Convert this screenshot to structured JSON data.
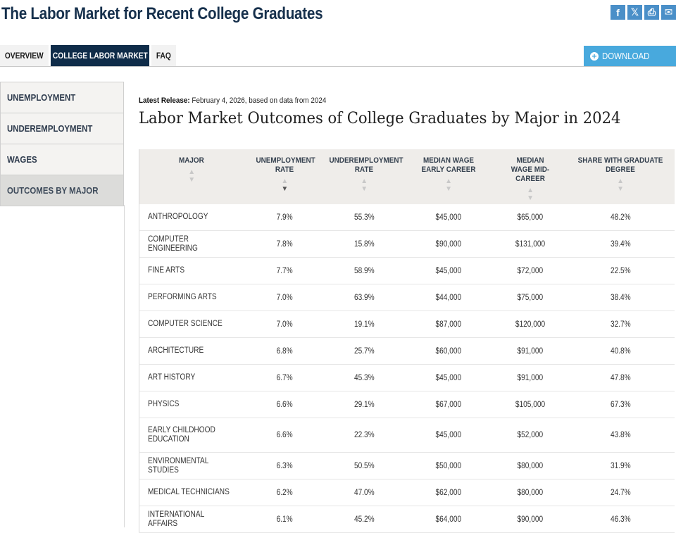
{
  "page_title": "The Labor Market for Recent College Graduates",
  "share_icons": [
    {
      "name": "facebook-icon",
      "glyph": "f"
    },
    {
      "name": "x-icon",
      "glyph": "𝕏"
    },
    {
      "name": "print-icon",
      "glyph": "⎙"
    },
    {
      "name": "email-icon",
      "glyph": "✉"
    }
  ],
  "tabs": {
    "overview": "OVERVIEW",
    "college_labor_market": "COLLEGE LABOR MARKET",
    "faq": "FAQ"
  },
  "download": {
    "icon": "+",
    "label": "DOWNLOAD"
  },
  "sidebar": {
    "items": [
      {
        "label": "UNEMPLOYMENT"
      },
      {
        "label": "UNDEREMPLOYMENT"
      },
      {
        "label": "WAGES"
      },
      {
        "label": "OUTCOMES BY MAJOR"
      }
    ]
  },
  "release": {
    "label": "Latest Release:",
    "text": "February 4, 2026, based on data from 2024"
  },
  "section_title": "Labor Market Outcomes of College Graduates by Major in 2024",
  "table": {
    "headers": [
      "MAJOR",
      "UNEMPLOYMENT RATE",
      "UNDEREMPLOYMENT RATE",
      "MEDIAN WAGE EARLY CAREER",
      "MEDIAN WAGE MID-CAREER",
      "SHARE WITH GRADUATE DEGREE"
    ],
    "sort_column": "UNEMPLOYMENT RATE",
    "sort_direction": "descending",
    "rows": [
      [
        "ANTHROPOLOGY",
        "7.9%",
        "55.3%",
        "$45,000",
        "$65,000",
        "48.2%"
      ],
      [
        "COMPUTER ENGINEERING",
        "7.8%",
        "15.8%",
        "$90,000",
        "$131,000",
        "39.4%"
      ],
      [
        "FINE ARTS",
        "7.7%",
        "58.9%",
        "$45,000",
        "$72,000",
        "22.5%"
      ],
      [
        "PERFORMING ARTS",
        "7.0%",
        "63.9%",
        "$44,000",
        "$75,000",
        "38.4%"
      ],
      [
        "COMPUTER SCIENCE",
        "7.0%",
        "19.1%",
        "$87,000",
        "$120,000",
        "32.7%"
      ],
      [
        "ARCHITECTURE",
        "6.8%",
        "25.7%",
        "$60,000",
        "$91,000",
        "40.8%"
      ],
      [
        "ART HISTORY",
        "6.7%",
        "45.3%",
        "$45,000",
        "$91,000",
        "47.8%"
      ],
      [
        "PHYSICS",
        "6.6%",
        "29.1%",
        "$67,000",
        "$105,000",
        "67.3%"
      ],
      [
        "EARLY CHILDHOOD EDUCATION",
        "6.6%",
        "22.3%",
        "$45,000",
        "$52,000",
        "43.8%"
      ],
      [
        "ENVIRONMENTAL STUDIES",
        "6.3%",
        "50.5%",
        "$50,000",
        "$80,000",
        "31.9%"
      ],
      [
        "MEDICAL TECHNICIANS",
        "6.2%",
        "47.0%",
        "$62,000",
        "$80,000",
        "24.7%"
      ],
      [
        "INTERNATIONAL AFFAIRS",
        "6.1%",
        "45.2%",
        "$64,000",
        "$90,000",
        "46.3%"
      ]
    ]
  }
}
